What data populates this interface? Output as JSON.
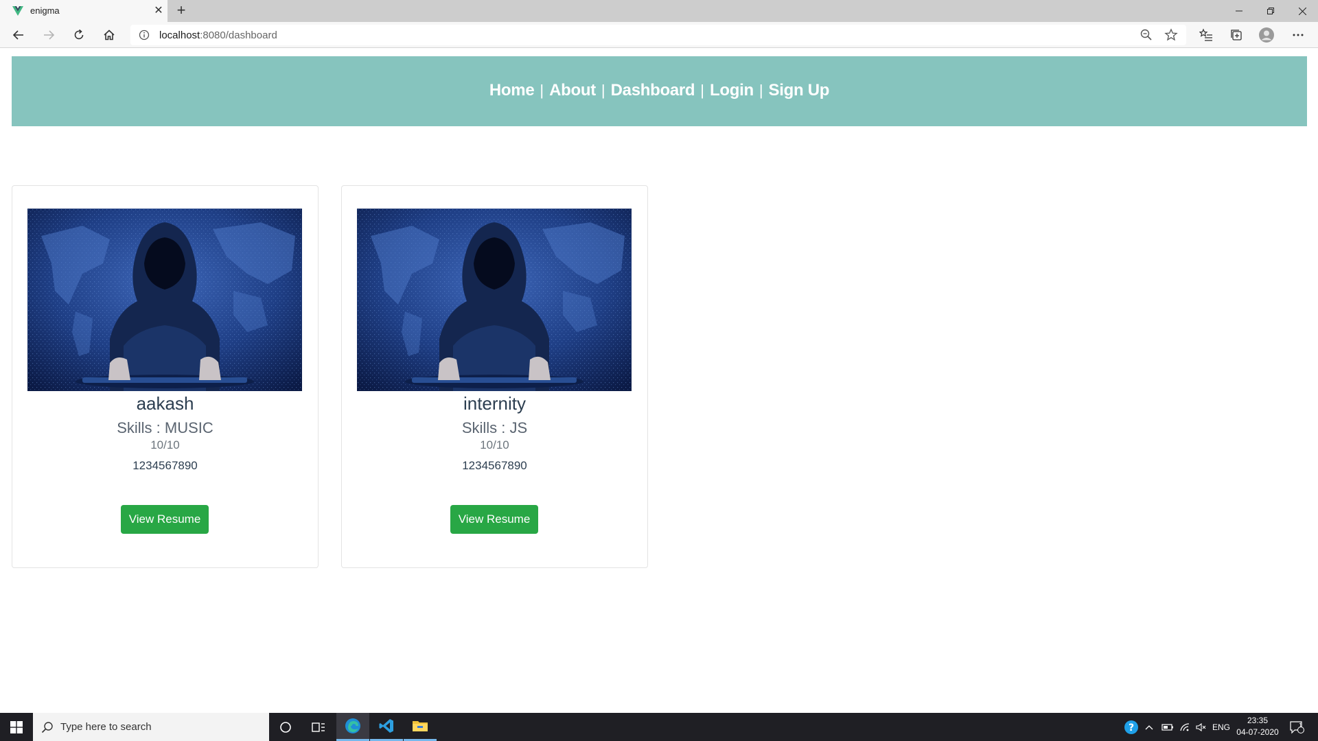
{
  "browser": {
    "tab_title": "enigma",
    "url_host": "localhost",
    "url_rest": ":8080/dashboard"
  },
  "nav": {
    "links": [
      "Home",
      "About",
      "Dashboard",
      "Login",
      "Sign Up"
    ],
    "separator": "|",
    "background": "#86c4be"
  },
  "cards": [
    {
      "name": "aakash",
      "skills": "Skills : MUSIC",
      "rating": "10/10",
      "phone": "1234567890",
      "button": "View Resume"
    },
    {
      "name": "internity",
      "skills": "Skills : JS",
      "rating": "10/10",
      "phone": "1234567890",
      "button": "View Resume"
    }
  ],
  "accent": {
    "button": "#28a745"
  },
  "taskbar": {
    "search_placeholder": "Type here to search",
    "language": "ENG",
    "time": "23:35",
    "date": "04-07-2020",
    "notification_count": "1"
  }
}
